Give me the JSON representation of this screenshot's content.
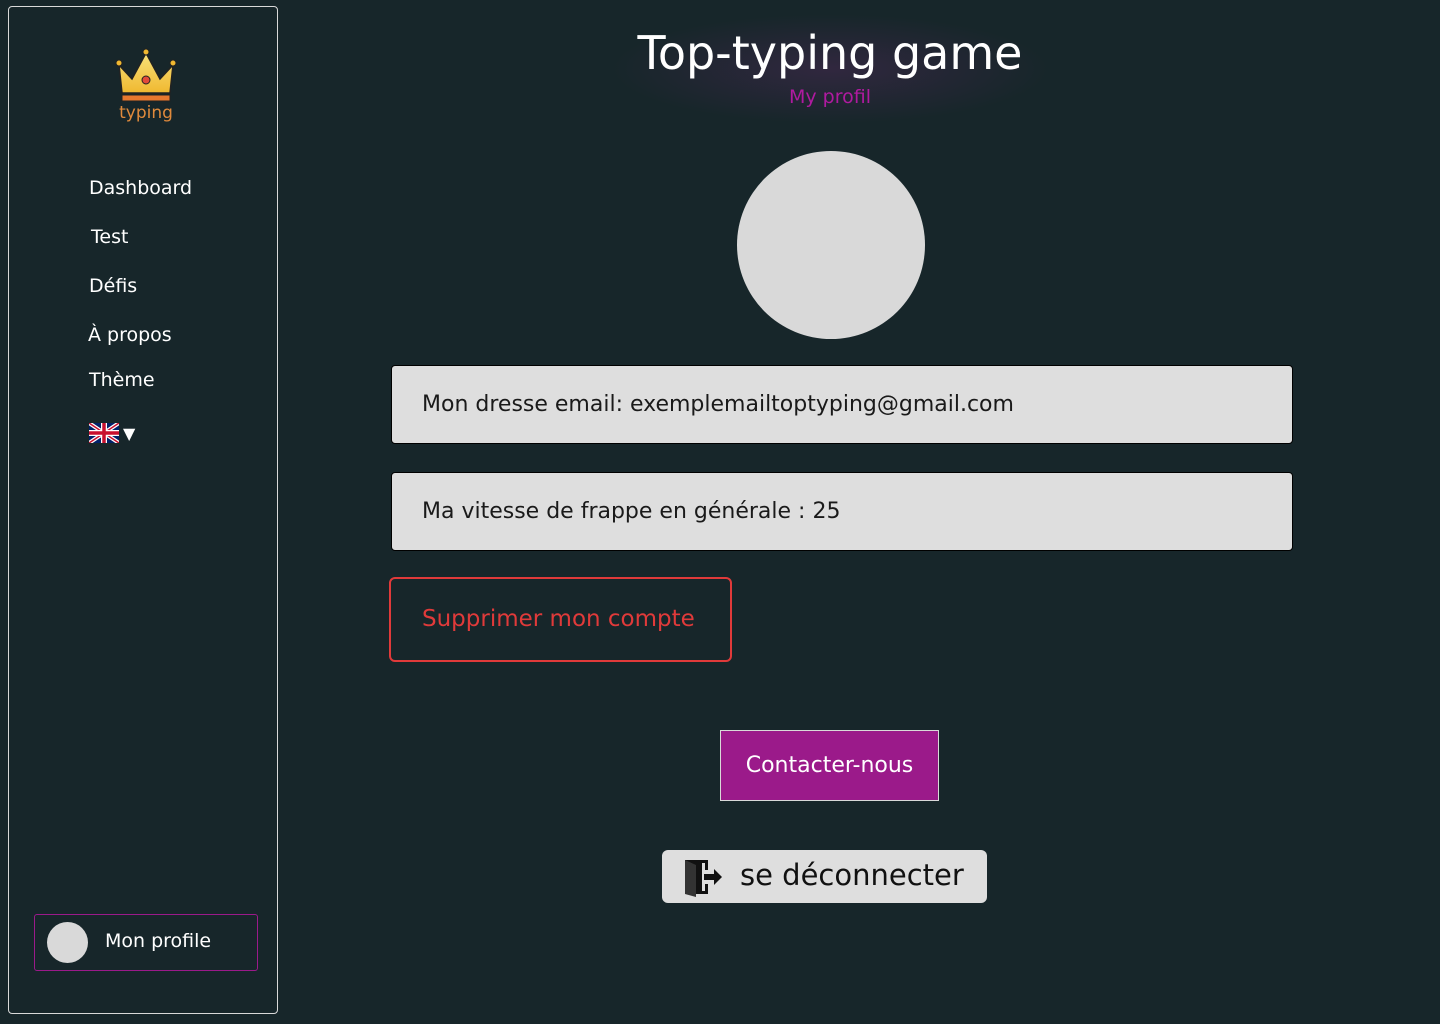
{
  "sidebar": {
    "logo_text": "typing",
    "items": [
      {
        "label": "Dashboard"
      },
      {
        "label": "Test"
      },
      {
        "label": "Défis"
      },
      {
        "label": "À propos"
      },
      {
        "label": "Thème"
      }
    ],
    "language": {
      "flag": "uk-flag-icon",
      "arrow": "▼"
    },
    "profile_label": "Mon profile"
  },
  "header": {
    "title": "Top-typing game",
    "subtitle": "My profil"
  },
  "profile": {
    "email_text": "Mon dresse email: exemplemailtoptyping@gmail.com",
    "speed_text": "Ma vitesse de frappe en générale : 25",
    "delete_label": "Supprimer mon compte",
    "contact_label": "Contacter-nous",
    "logout_label": "se déconnecter"
  },
  "colors": {
    "background": "#17262a",
    "accent": "#9b1a8a",
    "danger": "#e03a3a",
    "logo": "#e08a3c"
  }
}
